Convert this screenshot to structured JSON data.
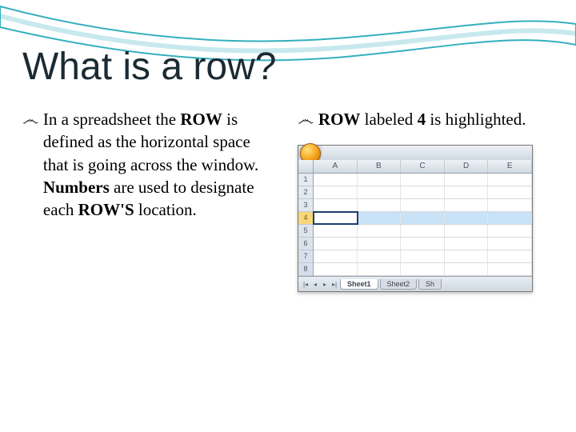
{
  "title": "What is a row?",
  "left": {
    "pre": "In a spreadsheet the ",
    "b1": "ROW",
    "mid1": " is defined as the horizontal space that is going across the window. ",
    "b2": "Numbers",
    "mid2": " are used to designate each ",
    "b3": "ROW'S",
    "post": " location."
  },
  "right": {
    "b1": "ROW",
    "mid": " labeled ",
    "b2": "4",
    "post": " is highlighted."
  },
  "sheet": {
    "cols": [
      "A",
      "B",
      "C",
      "D",
      "E"
    ],
    "rows": [
      "1",
      "2",
      "3",
      "4",
      "5",
      "6",
      "7",
      "8"
    ],
    "highlight_row": "4",
    "tabs": {
      "active": "Sheet1",
      "others": [
        "Sheet2",
        "Sh"
      ]
    }
  },
  "bullet_glyph": "෴"
}
